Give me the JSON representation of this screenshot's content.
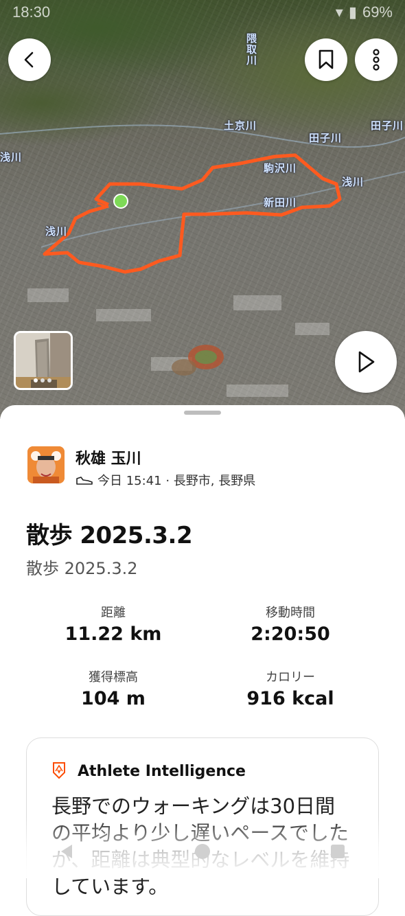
{
  "status_bar": {
    "time": "18:30",
    "battery": "69%"
  },
  "map": {
    "river_labels": [
      "隈取川",
      "土京川",
      "田子川",
      "田子川",
      "浅川",
      "新田川",
      "浅川",
      "駒沢川",
      "浅川"
    ],
    "route_color": "#ff5a1f",
    "start_marker_color": "#7ed957",
    "thumbnail_page_dots": 3
  },
  "activity": {
    "athlete_name": "秋雄 玉川",
    "meta": "今日 15:41 · 長野市, 長野県",
    "title": "散歩 2025.3.2",
    "description": "散歩 2025.3.2",
    "stats": [
      {
        "label": "距離",
        "value": "11.22 km"
      },
      {
        "label": "移動時間",
        "value": "2:20:50"
      },
      {
        "label": "獲得標高",
        "value": "104 m"
      },
      {
        "label": "カロリー",
        "value": "916 kcal"
      }
    ]
  },
  "athlete_intelligence": {
    "title": "Athlete Intelligence",
    "body": "長野でのウォーキングは30日間の平均より少し遅いペースでしたが、距離は典型的なレベルを維持しています。",
    "icon_color": "#fc4c02"
  },
  "colors": {
    "accent": "#fc4c02",
    "route": "#ff5a1f"
  }
}
